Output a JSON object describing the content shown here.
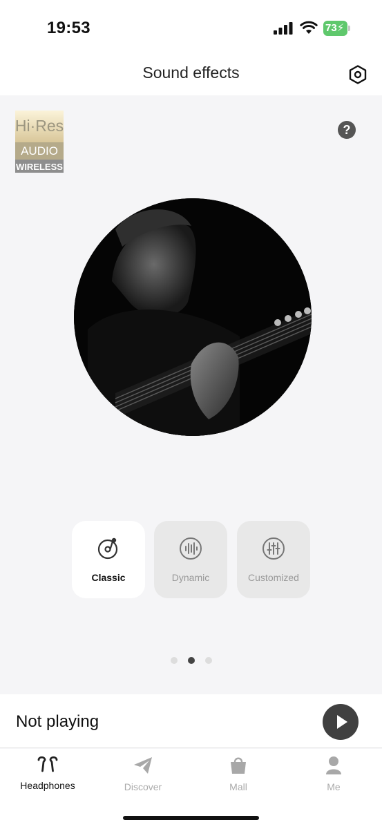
{
  "status_bar": {
    "time": "19:53",
    "battery": "73"
  },
  "header": {
    "title": "Sound effects",
    "settings_icon": "hexagon-settings-icon"
  },
  "badge": {
    "line1": "Hi·Res",
    "line2": "AUDIO",
    "line3": "WIRELESS"
  },
  "help": {
    "label": "?"
  },
  "modes": [
    {
      "label": "Classic",
      "icon": "vinyl-note-icon",
      "active": true
    },
    {
      "label": "Dynamic",
      "icon": "soundwave-icon",
      "active": false
    },
    {
      "label": "Customized",
      "icon": "equalizer-icon",
      "active": false
    }
  ],
  "pagination": {
    "count": 3,
    "active_index": 1
  },
  "player": {
    "status": "Not playing",
    "play_icon": "play-icon"
  },
  "tabs": [
    {
      "label": "Headphones",
      "icon": "earbuds-icon",
      "active": true
    },
    {
      "label": "Discover",
      "icon": "paper-plane-icon",
      "active": false
    },
    {
      "label": "Mall",
      "icon": "shopping-bag-icon",
      "active": false
    },
    {
      "label": "Me",
      "icon": "person-icon",
      "active": false
    }
  ],
  "colors": {
    "accent_dark": "#404040",
    "card_active": "#ffffff",
    "card_inactive": "#e8e8e8",
    "battery_green": "#5fc86c"
  }
}
